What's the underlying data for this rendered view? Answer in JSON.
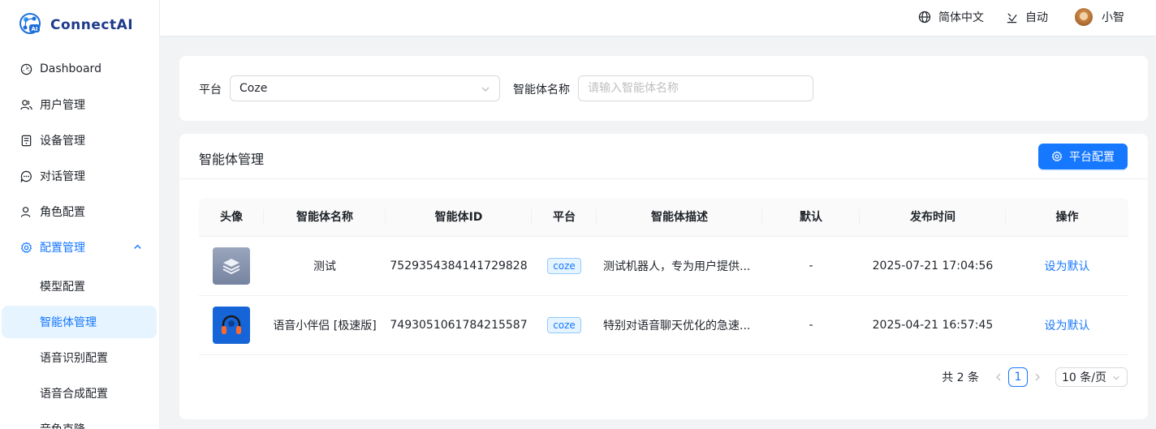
{
  "app": {
    "logo_text": "ConnectAI"
  },
  "sidebar": {
    "items": [
      {
        "label": "Dashboard",
        "icon": "dashboard-icon"
      },
      {
        "label": "用户管理",
        "icon": "users-icon"
      },
      {
        "label": "设备管理",
        "icon": "device-icon"
      },
      {
        "label": "对话管理",
        "icon": "chat-icon"
      },
      {
        "label": "角色配置",
        "icon": "person-icon"
      },
      {
        "label": "配置管理",
        "icon": "gear-icon",
        "expanded": true
      }
    ],
    "sub_items": [
      {
        "label": "模型配置"
      },
      {
        "label": "智能体管理",
        "active": true
      },
      {
        "label": "语音识别配置"
      },
      {
        "label": "语音合成配置"
      },
      {
        "label": "音色克隆"
      }
    ]
  },
  "header": {
    "language": "简体中文",
    "theme": "自动",
    "username": "小智"
  },
  "filters": {
    "platform_label": "平台",
    "platform_value": "Coze",
    "name_label": "智能体名称",
    "name_placeholder": "请输入智能体名称",
    "name_value": ""
  },
  "table_card": {
    "title": "智能体管理",
    "config_button": "平台配置",
    "columns": [
      "头像",
      "智能体名称",
      "智能体ID",
      "平台",
      "智能体描述",
      "默认",
      "发布时间",
      "操作"
    ],
    "rows": [
      {
        "avatar": "layers-icon",
        "name": "测试",
        "id": "7529354384141729828",
        "platform": "coze",
        "description": "测试机器人，专为用户提供...",
        "default": "-",
        "published": "2025-07-21 17:04:56",
        "action": "设为默认"
      },
      {
        "avatar": "headphones-icon",
        "name": "语音小伴侣 [极速版]",
        "id": "7493051061784215587",
        "platform": "coze",
        "description": "特别对语音聊天优化的急速...",
        "default": "-",
        "published": "2025-04-21 16:57:45",
        "action": "设为默认"
      }
    ]
  },
  "pagination": {
    "total_text": "共 2 条",
    "current_page": "1",
    "page_size": "10 条/页"
  },
  "colors": {
    "primary": "#1677ff",
    "active_bg": "#e6f4ff",
    "page_bg": "#f2f3f5"
  }
}
